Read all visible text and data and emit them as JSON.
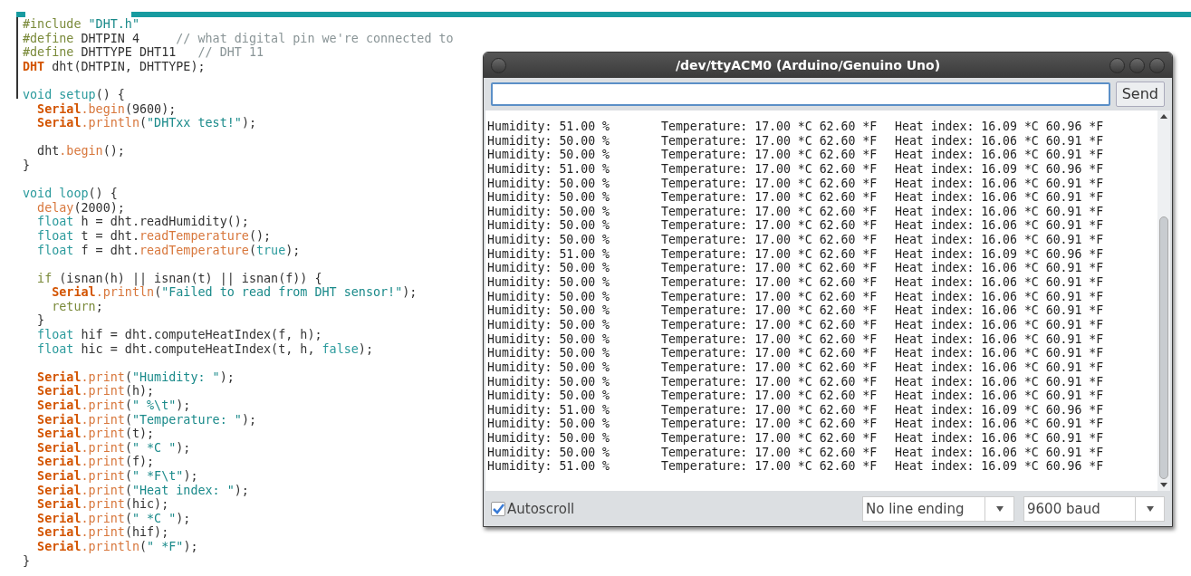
{
  "editor": {
    "lines": [
      {
        "kind": "code",
        "segments": [
          {
            "t": "#include ",
            "kind": "pre"
          },
          {
            "t": "\"DHT.h\"",
            "kind": "str"
          }
        ]
      },
      {
        "kind": "code",
        "segments": [
          {
            "t": "#define ",
            "kind": "pre"
          },
          {
            "t": "DHTPIN 4     ",
            "kind": "plain"
          },
          {
            "t": "// what digital pin we're connected to",
            "kind": "cmt"
          }
        ]
      },
      {
        "kind": "code",
        "segments": [
          {
            "t": "#define ",
            "kind": "pre"
          },
          {
            "t": "DHTTYPE DHT11   ",
            "kind": "plain"
          },
          {
            "t": "// DHT 11",
            "kind": "cmt"
          }
        ]
      },
      {
        "kind": "code",
        "segments": [
          {
            "t": "DHT",
            "kind": "cls"
          },
          {
            "t": " dht(DHTPIN, DHTTYPE);",
            "kind": "plain"
          }
        ]
      },
      {
        "kind": "blank"
      },
      {
        "kind": "code",
        "segments": [
          {
            "t": "void setup",
            "kind": "kw"
          },
          {
            "t": "() {",
            "kind": "plain"
          }
        ]
      },
      {
        "kind": "code",
        "segments": [
          {
            "t": "  Serial",
            "kind": "cls"
          },
          {
            "t": ".begin",
            "kind": "fn"
          },
          {
            "t": "(9600);",
            "kind": "plain"
          }
        ]
      },
      {
        "kind": "code",
        "segments": [
          {
            "t": "  Serial",
            "kind": "cls"
          },
          {
            "t": ".println",
            "kind": "fn"
          },
          {
            "t": "(",
            "kind": "plain"
          },
          {
            "t": "\"DHTxx test!\"",
            "kind": "str"
          },
          {
            "t": ");",
            "kind": "plain"
          }
        ]
      },
      {
        "kind": "blank"
      },
      {
        "kind": "code",
        "segments": [
          {
            "t": "  dht",
            "kind": "plain"
          },
          {
            "t": ".begin",
            "kind": "fn"
          },
          {
            "t": "();",
            "kind": "plain"
          }
        ]
      },
      {
        "kind": "code",
        "segments": [
          {
            "t": "}",
            "kind": "plain"
          }
        ]
      },
      {
        "kind": "blank"
      },
      {
        "kind": "code",
        "segments": [
          {
            "t": "void loop",
            "kind": "kw"
          },
          {
            "t": "() {",
            "kind": "plain"
          }
        ]
      },
      {
        "kind": "code",
        "segments": [
          {
            "t": "  delay",
            "kind": "fn"
          },
          {
            "t": "(2000);",
            "kind": "plain"
          }
        ]
      },
      {
        "kind": "code",
        "segments": [
          {
            "t": "  float",
            "kind": "kw"
          },
          {
            "t": " h = dht.readHumidity();",
            "kind": "plain"
          }
        ]
      },
      {
        "kind": "code",
        "segments": [
          {
            "t": "  float",
            "kind": "kw"
          },
          {
            "t": " t = dht.",
            "kind": "plain"
          },
          {
            "t": "readTemperature",
            "kind": "fn"
          },
          {
            "t": "();",
            "kind": "plain"
          }
        ]
      },
      {
        "kind": "code",
        "segments": [
          {
            "t": "  float",
            "kind": "kw"
          },
          {
            "t": " f = dht.",
            "kind": "plain"
          },
          {
            "t": "readTemperature",
            "kind": "fn"
          },
          {
            "t": "(",
            "kind": "plain"
          },
          {
            "t": "true",
            "kind": "kw"
          },
          {
            "t": ");",
            "kind": "plain"
          }
        ]
      },
      {
        "kind": "blank"
      },
      {
        "kind": "code",
        "segments": [
          {
            "t": "  if",
            "kind": "pre"
          },
          {
            "t": " (isnan(h) || isnan(t) || isnan(f)) {",
            "kind": "plain"
          }
        ]
      },
      {
        "kind": "code",
        "segments": [
          {
            "t": "    Serial",
            "kind": "cls"
          },
          {
            "t": ".println",
            "kind": "fn"
          },
          {
            "t": "(",
            "kind": "plain"
          },
          {
            "t": "\"Failed to read from DHT sensor!\"",
            "kind": "str"
          },
          {
            "t": ");",
            "kind": "plain"
          }
        ]
      },
      {
        "kind": "code",
        "segments": [
          {
            "t": "    return",
            "kind": "pre"
          },
          {
            "t": ";",
            "kind": "plain"
          }
        ]
      },
      {
        "kind": "code",
        "segments": [
          {
            "t": "  }",
            "kind": "plain"
          }
        ]
      },
      {
        "kind": "code",
        "segments": [
          {
            "t": "  float",
            "kind": "kw"
          },
          {
            "t": " hif = dht.computeHeatIndex(f, h);",
            "kind": "plain"
          }
        ]
      },
      {
        "kind": "code",
        "segments": [
          {
            "t": "  float",
            "kind": "kw"
          },
          {
            "t": " hic = dht.computeHeatIndex(t, h, ",
            "kind": "plain"
          },
          {
            "t": "false",
            "kind": "kw"
          },
          {
            "t": ");",
            "kind": "plain"
          }
        ]
      },
      {
        "kind": "blank"
      },
      {
        "kind": "code",
        "segments": [
          {
            "t": "  Serial",
            "kind": "cls"
          },
          {
            "t": ".print",
            "kind": "fn"
          },
          {
            "t": "(",
            "kind": "plain"
          },
          {
            "t": "\"Humidity: \"",
            "kind": "str"
          },
          {
            "t": ");",
            "kind": "plain"
          }
        ]
      },
      {
        "kind": "code",
        "segments": [
          {
            "t": "  Serial",
            "kind": "cls"
          },
          {
            "t": ".print",
            "kind": "fn"
          },
          {
            "t": "(h);",
            "kind": "plain"
          }
        ]
      },
      {
        "kind": "code",
        "segments": [
          {
            "t": "  Serial",
            "kind": "cls"
          },
          {
            "t": ".print",
            "kind": "fn"
          },
          {
            "t": "(",
            "kind": "plain"
          },
          {
            "t": "\" %\\t\"",
            "kind": "str"
          },
          {
            "t": ");",
            "kind": "plain"
          }
        ]
      },
      {
        "kind": "code",
        "segments": [
          {
            "t": "  Serial",
            "kind": "cls"
          },
          {
            "t": ".print",
            "kind": "fn"
          },
          {
            "t": "(",
            "kind": "plain"
          },
          {
            "t": "\"Temperature: \"",
            "kind": "str"
          },
          {
            "t": ");",
            "kind": "plain"
          }
        ]
      },
      {
        "kind": "code",
        "segments": [
          {
            "t": "  Serial",
            "kind": "cls"
          },
          {
            "t": ".print",
            "kind": "fn"
          },
          {
            "t": "(t);",
            "kind": "plain"
          }
        ]
      },
      {
        "kind": "code",
        "segments": [
          {
            "t": "  Serial",
            "kind": "cls"
          },
          {
            "t": ".print",
            "kind": "fn"
          },
          {
            "t": "(",
            "kind": "plain"
          },
          {
            "t": "\" *C \"",
            "kind": "str"
          },
          {
            "t": ");",
            "kind": "plain"
          }
        ]
      },
      {
        "kind": "code",
        "segments": [
          {
            "t": "  Serial",
            "kind": "cls"
          },
          {
            "t": ".print",
            "kind": "fn"
          },
          {
            "t": "(f);",
            "kind": "plain"
          }
        ]
      },
      {
        "kind": "code",
        "segments": [
          {
            "t": "  Serial",
            "kind": "cls"
          },
          {
            "t": ".print",
            "kind": "fn"
          },
          {
            "t": "(",
            "kind": "plain"
          },
          {
            "t": "\" *F\\t\"",
            "kind": "str"
          },
          {
            "t": ");",
            "kind": "plain"
          }
        ]
      },
      {
        "kind": "code",
        "segments": [
          {
            "t": "  Serial",
            "kind": "cls"
          },
          {
            "t": ".print",
            "kind": "fn"
          },
          {
            "t": "(",
            "kind": "plain"
          },
          {
            "t": "\"Heat index: \"",
            "kind": "str"
          },
          {
            "t": ");",
            "kind": "plain"
          }
        ]
      },
      {
        "kind": "code",
        "segments": [
          {
            "t": "  Serial",
            "kind": "cls"
          },
          {
            "t": ".print",
            "kind": "fn"
          },
          {
            "t": "(hic);",
            "kind": "plain"
          }
        ]
      },
      {
        "kind": "code",
        "segments": [
          {
            "t": "  Serial",
            "kind": "cls"
          },
          {
            "t": ".print",
            "kind": "fn"
          },
          {
            "t": "(",
            "kind": "plain"
          },
          {
            "t": "\" *C \"",
            "kind": "str"
          },
          {
            "t": ");",
            "kind": "plain"
          }
        ]
      },
      {
        "kind": "code",
        "segments": [
          {
            "t": "  Serial",
            "kind": "cls"
          },
          {
            "t": ".print",
            "kind": "fn"
          },
          {
            "t": "(hif);",
            "kind": "plain"
          }
        ]
      },
      {
        "kind": "code",
        "segments": [
          {
            "t": "  Serial",
            "kind": "cls"
          },
          {
            "t": ".println",
            "kind": "fn"
          },
          {
            "t": "(",
            "kind": "plain"
          },
          {
            "t": "\" *F\"",
            "kind": "str"
          },
          {
            "t": ");",
            "kind": "plain"
          }
        ]
      },
      {
        "kind": "code",
        "segments": [
          {
            "t": "}",
            "kind": "plain"
          }
        ]
      }
    ]
  },
  "serial_monitor": {
    "title": "/dev/ttyACM0 (Arduino/Genuino Uno)",
    "send_button": "Send",
    "output": [
      {
        "humidity": "Humidity: 51.00 %",
        "temperature": "Temperature: 17.00 *C 62.60 *F",
        "heat_index": "Heat index: 16.09 *C 60.96 *F"
      },
      {
        "humidity": "Humidity: 50.00 %",
        "temperature": "Temperature: 17.00 *C 62.60 *F",
        "heat_index": "Heat index: 16.06 *C 60.91 *F"
      },
      {
        "humidity": "Humidity: 50.00 %",
        "temperature": "Temperature: 17.00 *C 62.60 *F",
        "heat_index": "Heat index: 16.06 *C 60.91 *F"
      },
      {
        "humidity": "Humidity: 51.00 %",
        "temperature": "Temperature: 17.00 *C 62.60 *F",
        "heat_index": "Heat index: 16.09 *C 60.96 *F"
      },
      {
        "humidity": "Humidity: 50.00 %",
        "temperature": "Temperature: 17.00 *C 62.60 *F",
        "heat_index": "Heat index: 16.06 *C 60.91 *F"
      },
      {
        "humidity": "Humidity: 50.00 %",
        "temperature": "Temperature: 17.00 *C 62.60 *F",
        "heat_index": "Heat index: 16.06 *C 60.91 *F"
      },
      {
        "humidity": "Humidity: 50.00 %",
        "temperature": "Temperature: 17.00 *C 62.60 *F",
        "heat_index": "Heat index: 16.06 *C 60.91 *F"
      },
      {
        "humidity": "Humidity: 50.00 %",
        "temperature": "Temperature: 17.00 *C 62.60 *F",
        "heat_index": "Heat index: 16.06 *C 60.91 *F"
      },
      {
        "humidity": "Humidity: 50.00 %",
        "temperature": "Temperature: 17.00 *C 62.60 *F",
        "heat_index": "Heat index: 16.06 *C 60.91 *F"
      },
      {
        "humidity": "Humidity: 51.00 %",
        "temperature": "Temperature: 17.00 *C 62.60 *F",
        "heat_index": "Heat index: 16.09 *C 60.96 *F"
      },
      {
        "humidity": "Humidity: 50.00 %",
        "temperature": "Temperature: 17.00 *C 62.60 *F",
        "heat_index": "Heat index: 16.06 *C 60.91 *F"
      },
      {
        "humidity": "Humidity: 50.00 %",
        "temperature": "Temperature: 17.00 *C 62.60 *F",
        "heat_index": "Heat index: 16.06 *C 60.91 *F"
      },
      {
        "humidity": "Humidity: 50.00 %",
        "temperature": "Temperature: 17.00 *C 62.60 *F",
        "heat_index": "Heat index: 16.06 *C 60.91 *F"
      },
      {
        "humidity": "Humidity: 50.00 %",
        "temperature": "Temperature: 17.00 *C 62.60 *F",
        "heat_index": "Heat index: 16.06 *C 60.91 *F"
      },
      {
        "humidity": "Humidity: 50.00 %",
        "temperature": "Temperature: 17.00 *C 62.60 *F",
        "heat_index": "Heat index: 16.06 *C 60.91 *F"
      },
      {
        "humidity": "Humidity: 50.00 %",
        "temperature": "Temperature: 17.00 *C 62.60 *F",
        "heat_index": "Heat index: 16.06 *C 60.91 *F"
      },
      {
        "humidity": "Humidity: 50.00 %",
        "temperature": "Temperature: 17.00 *C 62.60 *F",
        "heat_index": "Heat index: 16.06 *C 60.91 *F"
      },
      {
        "humidity": "Humidity: 50.00 %",
        "temperature": "Temperature: 17.00 *C 62.60 *F",
        "heat_index": "Heat index: 16.06 *C 60.91 *F"
      },
      {
        "humidity": "Humidity: 50.00 %",
        "temperature": "Temperature: 17.00 *C 62.60 *F",
        "heat_index": "Heat index: 16.06 *C 60.91 *F"
      },
      {
        "humidity": "Humidity: 50.00 %",
        "temperature": "Temperature: 17.00 *C 62.60 *F",
        "heat_index": "Heat index: 16.06 *C 60.91 *F"
      },
      {
        "humidity": "Humidity: 51.00 %",
        "temperature": "Temperature: 17.00 *C 62.60 *F",
        "heat_index": "Heat index: 16.09 *C 60.96 *F"
      },
      {
        "humidity": "Humidity: 50.00 %",
        "temperature": "Temperature: 17.00 *C 62.60 *F",
        "heat_index": "Heat index: 16.06 *C 60.91 *F"
      },
      {
        "humidity": "Humidity: 50.00 %",
        "temperature": "Temperature: 17.00 *C 62.60 *F",
        "heat_index": "Heat index: 16.06 *C 60.91 *F"
      },
      {
        "humidity": "Humidity: 50.00 %",
        "temperature": "Temperature: 17.00 *C 62.60 *F",
        "heat_index": "Heat index: 16.06 *C 60.91 *F"
      },
      {
        "humidity": "Humidity: 51.00 %",
        "temperature": "Temperature: 17.00 *C 62.60 *F",
        "heat_index": "Heat index: 16.09 *C 60.96 *F"
      }
    ],
    "autoscroll": {
      "label": "Autoscroll",
      "checked": true
    },
    "line_ending": "No line ending",
    "baud_rate": "9600 baud"
  }
}
